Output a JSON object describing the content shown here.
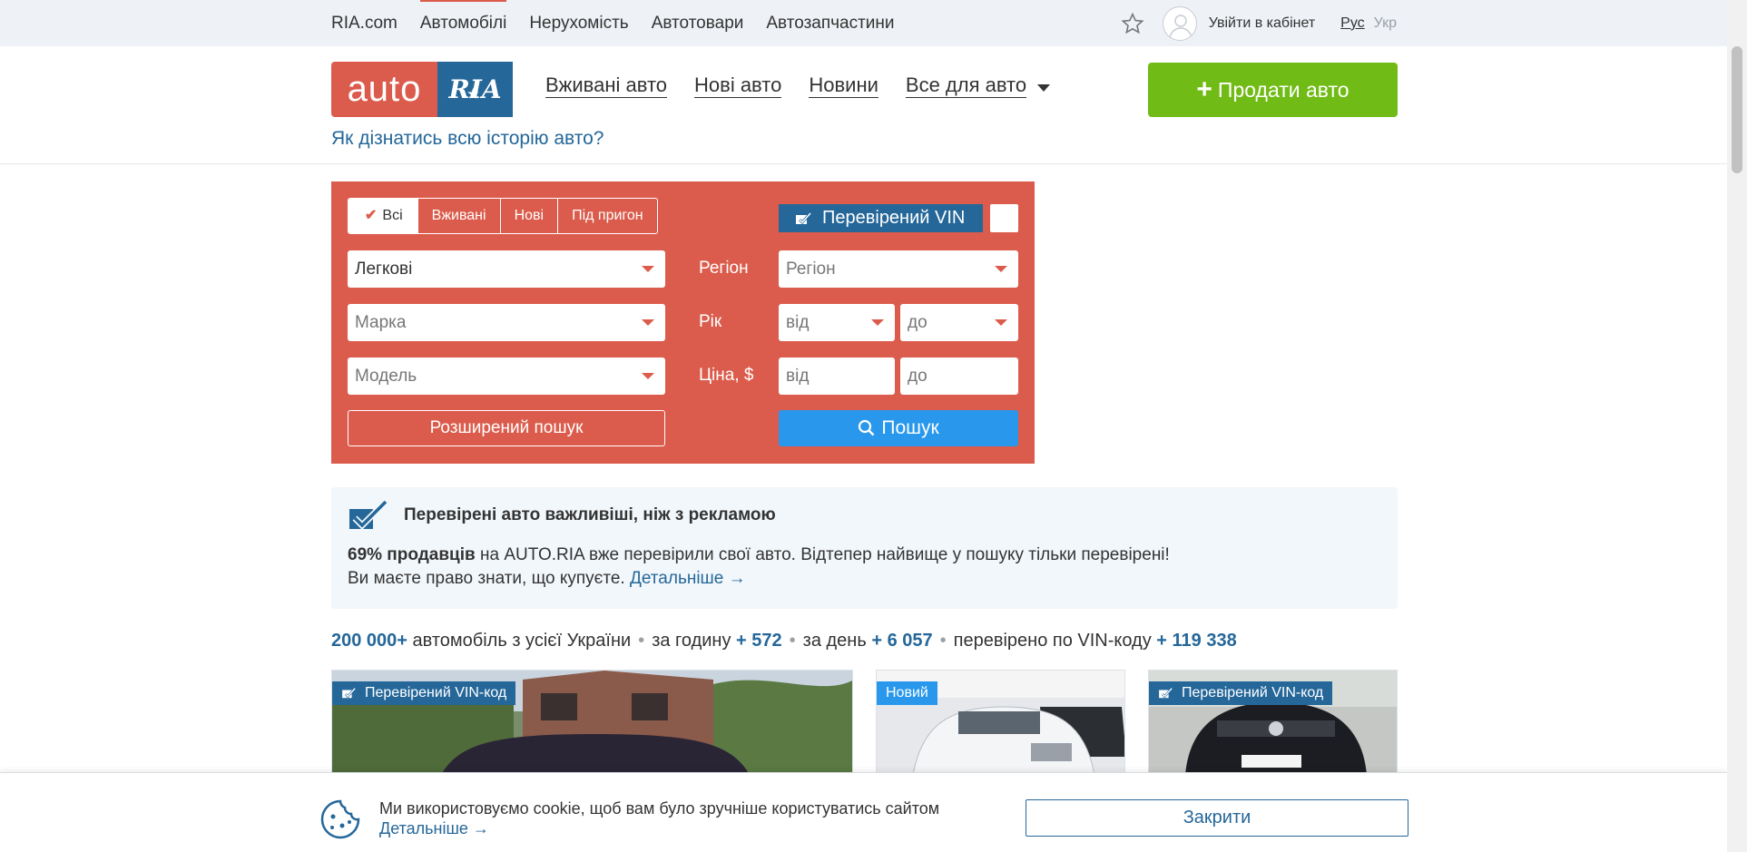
{
  "topbar": {
    "links": [
      "RIA.com",
      "Автомобілі",
      "Нерухомість",
      "Автотовари",
      "Автозапчастини"
    ],
    "login": "Увійти в кабінет",
    "lang_ru": "Рус",
    "lang_uk": "Укр"
  },
  "header": {
    "logo_auto": "auto",
    "logo_ria": "RIA",
    "nav": [
      "Вживані авто",
      "Нові авто",
      "Новини",
      "Все для авто"
    ],
    "sell_button": "Продати авто",
    "history_link": "Як дізнатись всю історію авто?"
  },
  "search": {
    "tabs": [
      "Всі",
      "Вживані",
      "Нові",
      "Під пригон"
    ],
    "vin_label": "Перевірений VIN",
    "type_value": "Легкові",
    "brand_placeholder": "Марка",
    "model_placeholder": "Модель",
    "region_label": "Регіон",
    "region_placeholder": "Регіон",
    "year_label": "Рік",
    "year_from": "від",
    "year_to": "до",
    "price_label": "Ціна, $",
    "price_from": "від",
    "price_to": "до",
    "advanced": "Розширений пошук",
    "search_button": "Пошук"
  },
  "promo": {
    "title": "Перевірені авто важливіші, ніж з рекламою",
    "bold": "69% продавців",
    "text1": " на AUTO.RIA вже перевірили свої авто. Відтепер найвище у пошуку тільки перевірені!",
    "text2": "Ви маєте право знати, що купуєте. ",
    "more": "Детальніше →"
  },
  "stats": {
    "total": "200 000+",
    "total_text": " автомобіль з усієї України",
    "hour_text": "за годину ",
    "hour": "+ 572",
    "day_text": "за день ",
    "day": "+ 6 057",
    "vin_text": "перевірено по VIN-коду ",
    "vin": "+ 119 338"
  },
  "cards": [
    {
      "badge": "Перевірений VIN-код"
    },
    {
      "badge": "Новий"
    },
    {
      "badge": "Перевірений VIN-код"
    }
  ],
  "cookie": {
    "text": "Ми використовуємо cookie, щоб вам було зручніше користуватись сайтом",
    "more": "Детальніше →",
    "close": "Закрити"
  },
  "colors": {
    "brand_red": "#db5c4c",
    "brand_blue": "#256799",
    "sell_green": "#71bb16",
    "search_blue": "#2998ec"
  }
}
